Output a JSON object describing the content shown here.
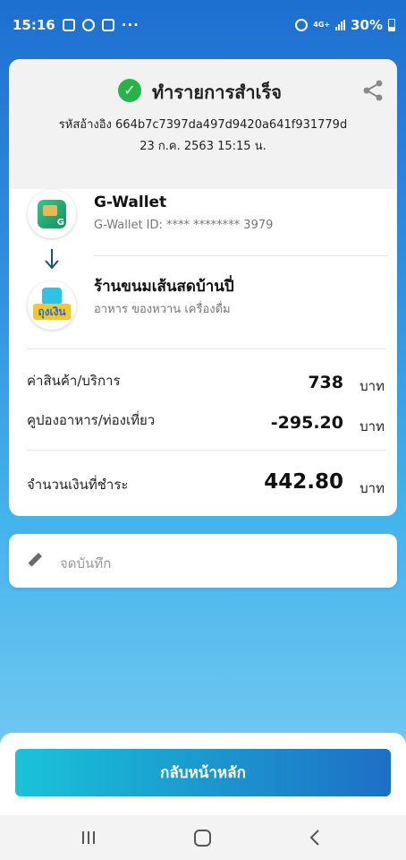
{
  "status_bar": {
    "time": "15:16",
    "network": "4G+",
    "battery": "30%",
    "icons": [
      "instagram-icon",
      "line-icon",
      "gmail-icon",
      "more-icon",
      "alarm-icon",
      "signal-icon",
      "battery-icon"
    ]
  },
  "receipt": {
    "title": "ทำรายการสำเร็จ",
    "reference": "รหัสอ้างอิง 664b7c7397da497d9420a641f931779d",
    "datetime": "23 ก.ค. 2563 15:15 น.",
    "from": {
      "name": "G-Wallet",
      "detail": "G-Wallet ID: **** ******** 3979",
      "logo_letter": "G"
    },
    "to": {
      "name": "ร้านขนมเส้นสดบ้านปี่",
      "detail": "อาหาร ของหวาน เครื่องดื่ม",
      "logo_text": "ถุงเงิน"
    },
    "lines": [
      {
        "label": "ค่าสินค้า/บริการ",
        "amount": "738",
        "unit": "บาท"
      },
      {
        "label": "คูปองอาหาร/ท่องเที่ยว",
        "amount": "-295.20",
        "unit": "บาท"
      }
    ],
    "total": {
      "label": "จำนวนเงินที่ชำระ",
      "amount": "442.80",
      "unit": "บาท"
    }
  },
  "note": {
    "placeholder": "จดบันทึก"
  },
  "actions": {
    "home_label": "กลับหน้าหลัก"
  },
  "colors": {
    "success": "#27b24a",
    "button_start": "#19c3d8",
    "button_end": "#1d6fc6"
  }
}
